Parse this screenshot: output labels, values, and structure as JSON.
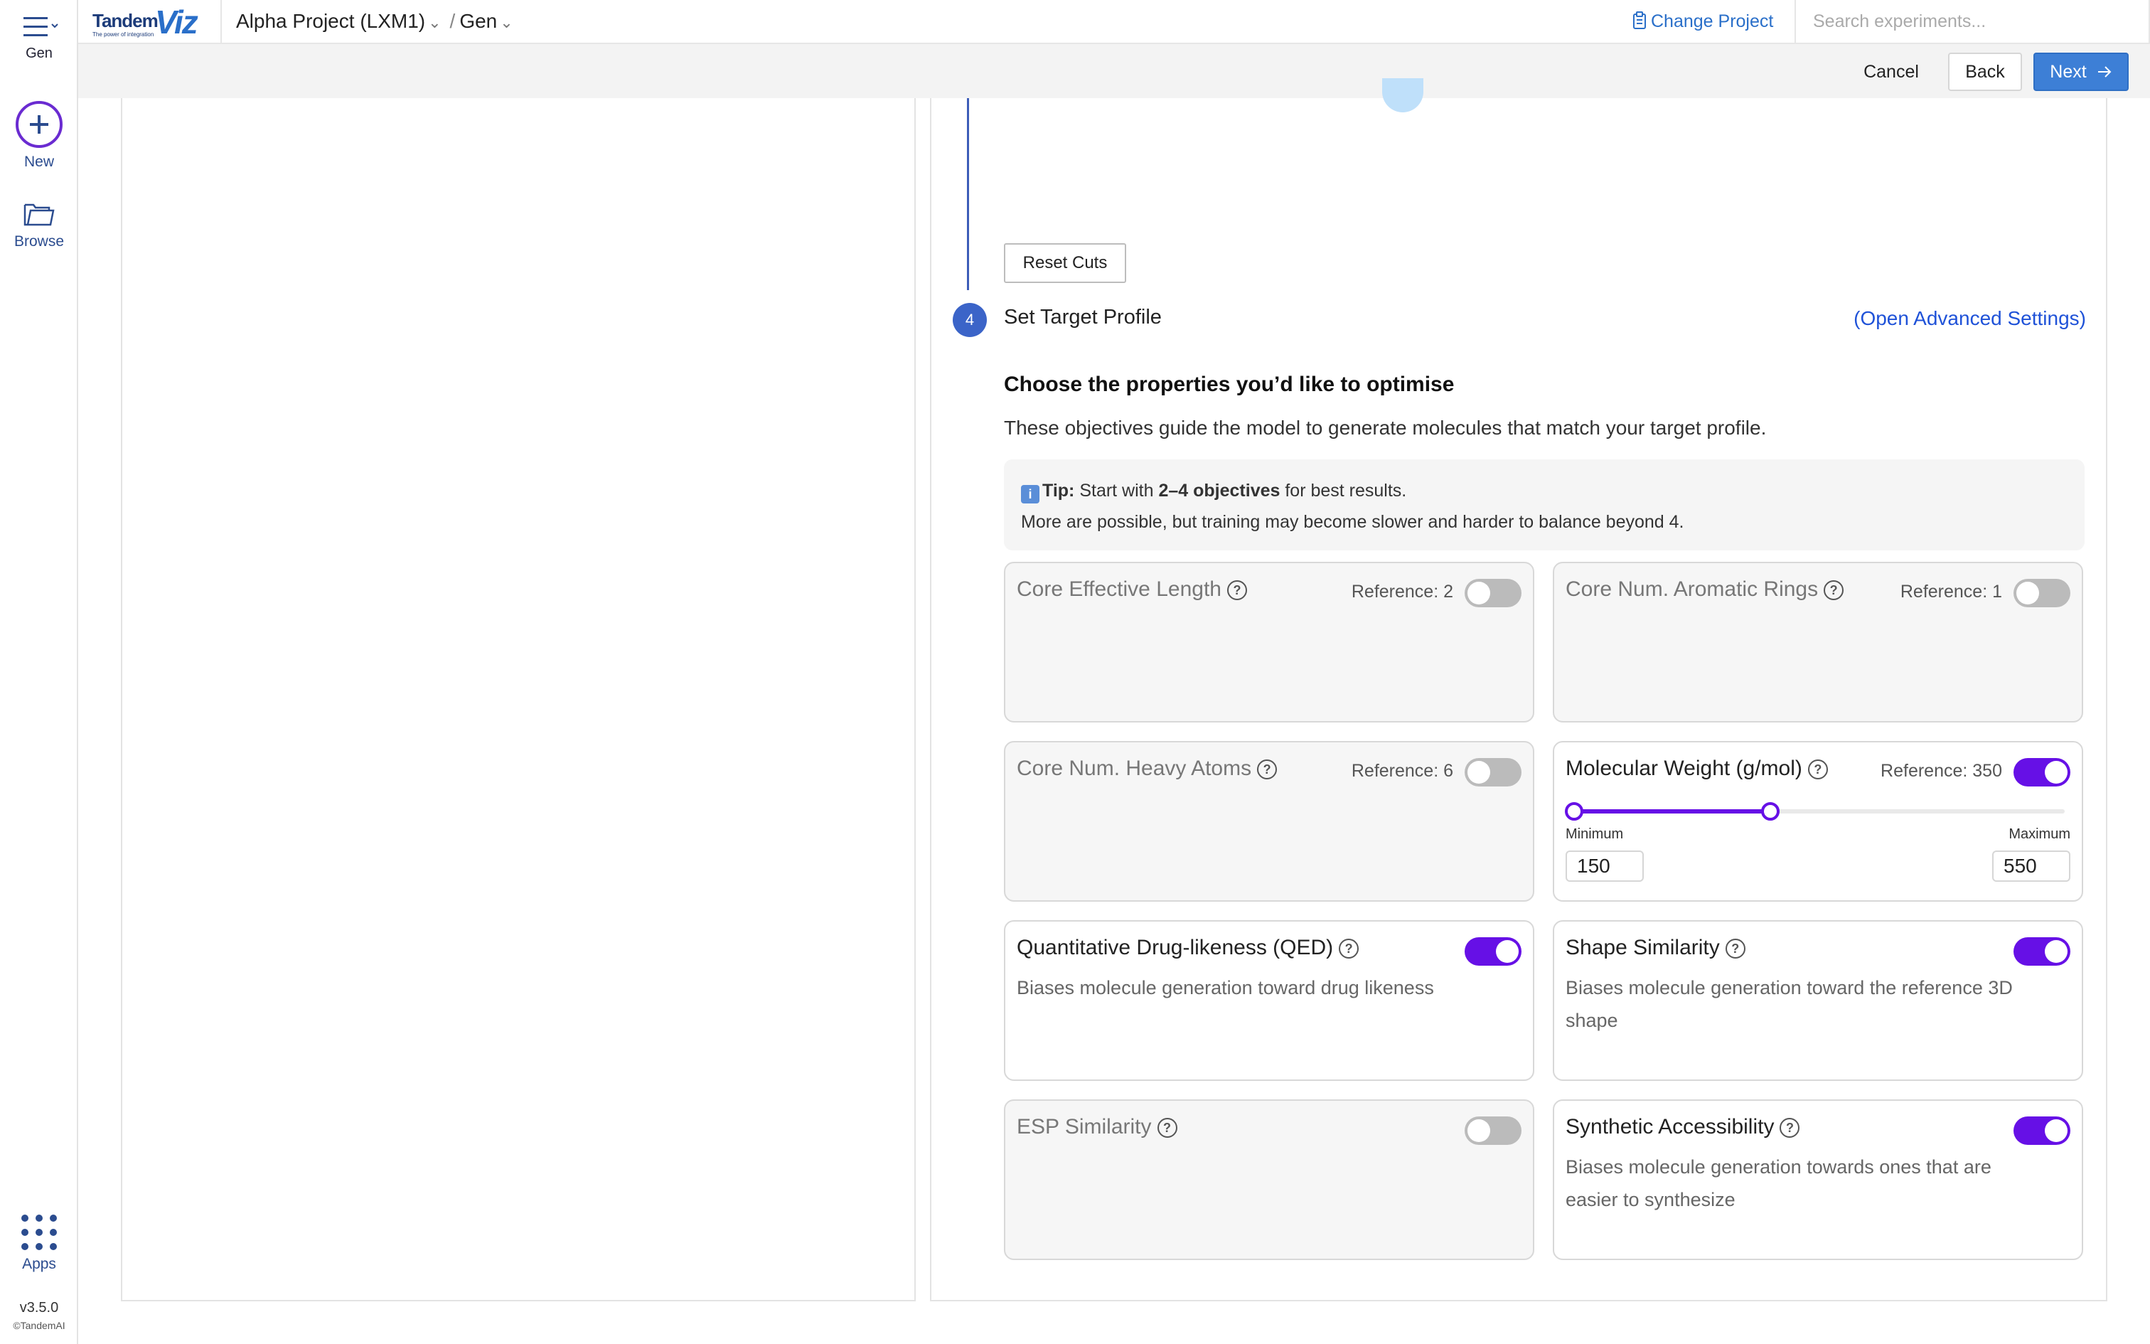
{
  "app": {
    "logo_primary": "Tandem",
    "logo_secondary": "Viz",
    "logo_tagline": "The power of integration",
    "project_name": "Alpha Project (LXM1)",
    "section_name": "Gen",
    "change_project_label": "Change Project",
    "search_placeholder": "Search experiments..."
  },
  "rail": {
    "menu_label": "Gen",
    "new_label": "New",
    "browse_label": "Browse",
    "apps_label": "Apps",
    "version": "v3.5.0",
    "copyright": "©TandemAI"
  },
  "actions": {
    "cancel": "Cancel",
    "back": "Back",
    "next": "Next"
  },
  "wizard": {
    "reset_cuts_label": "Reset Cuts",
    "step_number": "4",
    "step_title": "Set Target Profile",
    "advanced_link": "(Open Advanced Settings)",
    "heading": "Choose the properties you’d like to optimise",
    "description": "These objectives guide the model to generate molecules that match your target profile.",
    "tip": {
      "icon": "info-icon",
      "label": "Tip:",
      "text_before": " Start with ",
      "emphasis": "2–4 objectives",
      "text_after": " for best results.",
      "line2": "More are possible, but training may become slower and harder to balance beyond 4."
    }
  },
  "objectives": [
    {
      "title": "Core Effective Length",
      "reference": "Reference: 2",
      "enabled": false,
      "description": ""
    },
    {
      "title": "Core Num. Aromatic Rings",
      "reference": "Reference: 1",
      "enabled": false,
      "description": ""
    },
    {
      "title": "Core Num. Heavy Atoms",
      "reference": "Reference: 6",
      "enabled": false,
      "description": ""
    },
    {
      "title": "Molecular Weight (g/mol)",
      "reference": "Reference: 350",
      "enabled": true,
      "description": "",
      "range": {
        "min_label": "Minimum",
        "max_label": "Maximum",
        "min_value": "150",
        "max_value": "550",
        "slider_low_fraction": 0.0,
        "slider_high_fraction": 0.4
      }
    },
    {
      "title": "Quantitative Drug-likeness (QED)",
      "reference": "",
      "enabled": true,
      "description": "Biases molecule generation toward drug likeness"
    },
    {
      "title": "Shape Similarity",
      "reference": "",
      "enabled": true,
      "description": "Biases molecule generation toward the reference 3D shape"
    },
    {
      "title": "ESP Similarity",
      "reference": "",
      "enabled": false,
      "description": ""
    },
    {
      "title": "Synthetic Accessibility",
      "reference": "",
      "enabled": true,
      "description": "Biases molecule generation towards ones that are easier to synthesize"
    }
  ],
  "colors": {
    "accent_purple": "#6610e6",
    "primary_blue": "#3d7fd6",
    "link_blue": "#1f52d8",
    "step_badge": "#3b64c8"
  }
}
